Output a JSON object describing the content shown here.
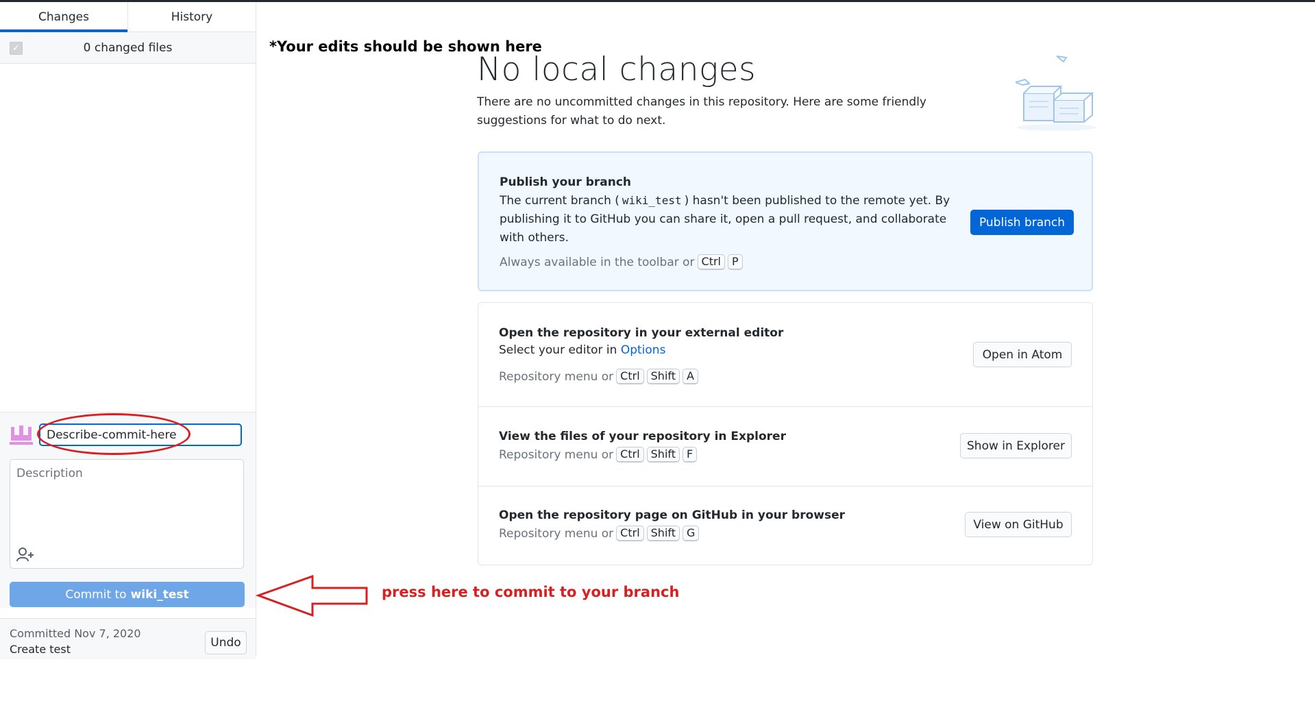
{
  "tabs": {
    "changes": "Changes",
    "history": "History"
  },
  "changes_list": {
    "count_label": "0 changed files"
  },
  "commit": {
    "summary_value": "Describe-commit-here",
    "description_placeholder": "Description",
    "button_prefix": "Commit to",
    "button_branch": "wiki_test"
  },
  "last_commit": {
    "date": "Committed Nov 7, 2020",
    "message": "Create test",
    "undo_label": "Undo"
  },
  "annotations": {
    "top_note": "*Your edits should be shown here",
    "arrow_note": "press here to commit to your branch"
  },
  "main": {
    "title": "No local changes",
    "subtitle": "There are no uncommitted changes in this repository. Here are some friendly suggestions for what to do next."
  },
  "publish": {
    "title": "Publish your branch",
    "text_before": "The current branch (",
    "branch": "wiki_test",
    "text_after": ") hasn't been published to the remote yet. By publishing it to GitHub you can share it, open a pull request, and collaborate with others.",
    "hint": "Always available in the toolbar or",
    "keys": [
      "Ctrl",
      "P"
    ],
    "button": "Publish branch"
  },
  "editor": {
    "title": "Open the repository in your external editor",
    "text": "Select your editor in",
    "link": "Options",
    "hint": "Repository menu or",
    "keys": [
      "Ctrl",
      "Shift",
      "A"
    ],
    "button": "Open in Atom"
  },
  "explorer": {
    "title": "View the files of your repository in Explorer",
    "hint": "Repository menu or",
    "keys": [
      "Ctrl",
      "Shift",
      "F"
    ],
    "button": "Show in Explorer"
  },
  "github": {
    "title": "Open the repository page on GitHub in your browser",
    "hint": "Repository menu or",
    "keys": [
      "Ctrl",
      "Shift",
      "G"
    ],
    "button": "View on GitHub"
  },
  "colors": {
    "accent": "#0366d6",
    "annotation_red": "#d92020",
    "commit_button": "#6ea6e8"
  }
}
